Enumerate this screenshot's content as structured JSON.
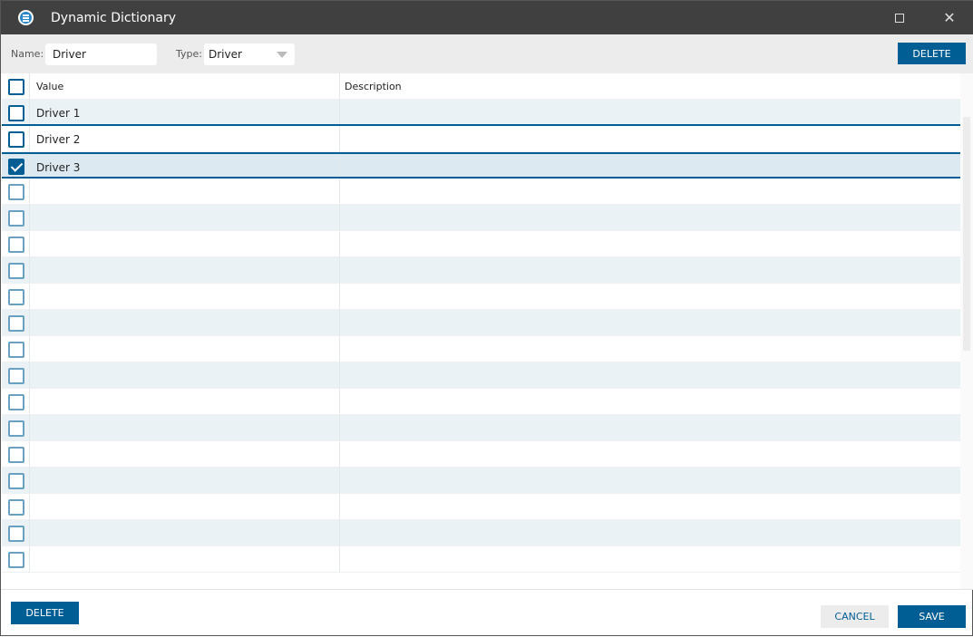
{
  "window": {
    "title": "Dynamic Dictionary"
  },
  "toolbar": {
    "name_label": "Name:",
    "name_value": "Driver",
    "type_label": "Type:",
    "type_value": "Driver",
    "delete_label": "DELETE"
  },
  "grid": {
    "headers": [
      "Value",
      "Description"
    ],
    "rows": [
      {
        "value": "Driver 1",
        "description": "",
        "checked": false
      },
      {
        "value": "Driver 2",
        "description": "",
        "checked": false
      },
      {
        "value": "Driver 3",
        "description": "",
        "checked": true
      }
    ],
    "empty_rows": 15
  },
  "footer": {
    "delete_label": "DELETE",
    "cancel_label": "CANCEL",
    "save_label": "SAVE"
  },
  "colors": {
    "accent": "#005e95",
    "titlebar": "#404040"
  }
}
